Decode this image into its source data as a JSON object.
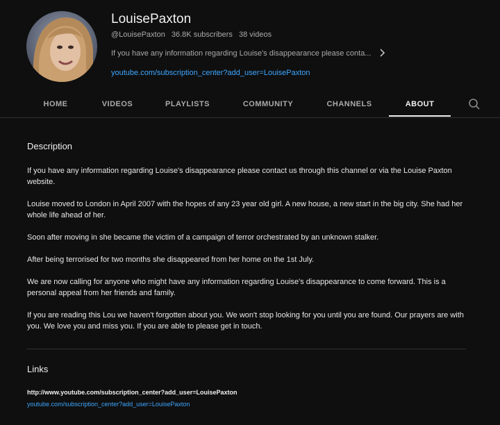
{
  "channel": {
    "name": "LouisePaxton",
    "handle": "@LouisePaxton",
    "subscribers": "36.8K subscribers",
    "videos": "38 videos",
    "about_snippet": "If you have any information regarding Louise's disappearance please conta...",
    "link": "youtube.com/subscription_center?add_user=LouisePaxton"
  },
  "tabs": [
    {
      "label": "HOME"
    },
    {
      "label": "VIDEOS"
    },
    {
      "label": "PLAYLISTS"
    },
    {
      "label": "COMMUNITY"
    },
    {
      "label": "CHANNELS"
    },
    {
      "label": "ABOUT",
      "active": true
    }
  ],
  "description": {
    "title": "Description",
    "paragraphs": [
      "If you have any information regarding Louise's disappearance please contact us through this channel or via the Louise Paxton website.",
      "Louise moved to London in April 2007 with the hopes of any 23 year old girl.  A new house, a new start in the big city.  She had her whole life ahead of her.",
      "Soon after moving in she became the victim of a campaign of terror orchestrated by an unknown stalker.",
      "After being terrorised for two months she disappeared from her home on the 1st July.",
      "We are now calling for anyone who might have any information regarding Louise's disappearance to come forward.  This is a personal appeal from her friends and family.",
      "If you are reading this Lou we haven't forgotten about you.  We won't stop looking for you until you are found.  Our prayers are with you.  We love you and miss you.  If you are able to please get in touch."
    ]
  },
  "links": {
    "title": "Links",
    "items": [
      {
        "title": "http://www.youtube.com/subscription_center?add_user=LouisePaxton",
        "url": "youtube.com/subscription_center?add_user=LouisePaxton"
      }
    ]
  },
  "icons": {
    "search": "search-icon",
    "chevron": "chevron-right-icon"
  },
  "colors": {
    "background": "#0f0f0f",
    "link": "#3ea6ff",
    "secondary_text": "#aaaaaa"
  }
}
